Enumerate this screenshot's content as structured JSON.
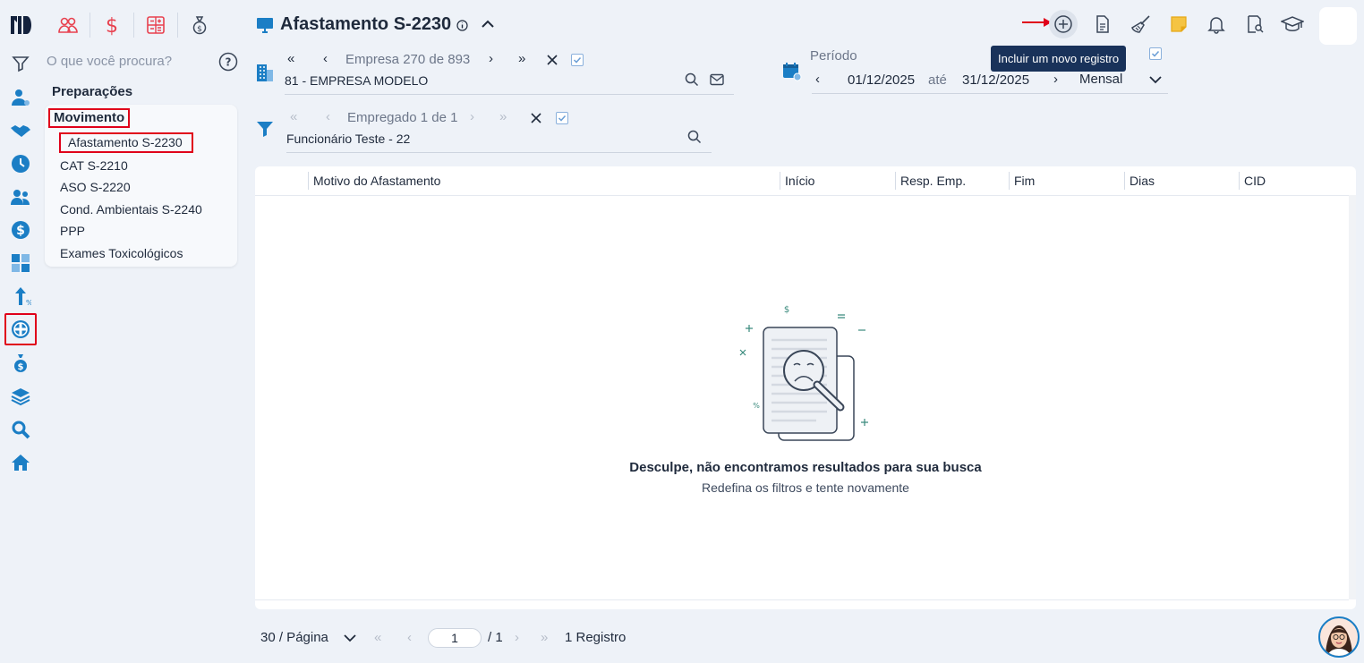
{
  "search": {
    "placeholder": "O que você procura?"
  },
  "menu": {
    "section_title": "Preparações",
    "group_label": "Movimento",
    "items": [
      {
        "label": "Afastamento S-2230"
      },
      {
        "label": "CAT S-2210"
      },
      {
        "label": "ASO S-2220"
      },
      {
        "label": "Cond. Ambientais S-2240"
      },
      {
        "label": "PPP"
      },
      {
        "label": "Exames Toxicológicos"
      }
    ]
  },
  "header": {
    "title": "Afastamento S-2230"
  },
  "toolbar": {
    "add_tooltip": "Incluir um novo registro"
  },
  "company": {
    "nav_label": "Empresa 270 de 893",
    "value": "81 - EMPRESA MODELO"
  },
  "employee": {
    "nav_label": "Empregado 1 de 1",
    "value": "Funcionário Teste - 22"
  },
  "period": {
    "label": "Período",
    "start": "01/12/2025",
    "connector": "até",
    "end": "31/12/2025",
    "mode": "Mensal"
  },
  "table": {
    "columns": [
      "Motivo do Afastamento",
      "Início",
      "Resp. Emp.",
      "Fim",
      "Dias",
      "CID"
    ],
    "empty_title": "Desculpe, não encontramos resultados para sua busca",
    "empty_subtitle": "Redefina os filtros e tente novamente"
  },
  "pagination": {
    "page_size": "30 / Página",
    "current_page": "1",
    "total_pages": "/ 1",
    "record_count": "1 Registro"
  },
  "colors": {
    "accent": "#1b7ec5",
    "module_red": "#e8414f",
    "highlight_red": "#e0001a",
    "tooltip_bg": "#19325a"
  }
}
